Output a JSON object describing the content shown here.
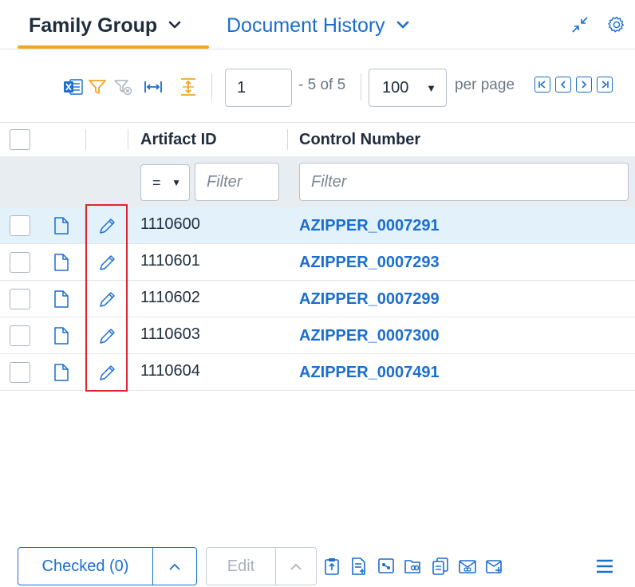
{
  "tabs": [
    {
      "label": "Family Group",
      "chevron": "⌄",
      "active": true
    },
    {
      "label": "Document History",
      "chevron": "⌄",
      "active": false
    }
  ],
  "tab_icons": [
    "collapse-arrows-icon",
    "gear-icon"
  ],
  "toolbar": {
    "page_input_value": "1",
    "page_range": "- 5 of 5",
    "per_page_value": "100",
    "per_page_label": "per page",
    "pager_buttons": [
      "|<",
      "<",
      ">",
      ">|"
    ]
  },
  "grid": {
    "columns": [
      "Artifact ID",
      "Control Number"
    ],
    "filter": {
      "operator": "=",
      "artifact_placeholder": "Filter",
      "control_placeholder": "Filter"
    },
    "rows": [
      {
        "artifact_id": "1110600",
        "control_number": "AZIPPER_0007291",
        "selected": true
      },
      {
        "artifact_id": "1110601",
        "control_number": "AZIPPER_0007293",
        "selected": false
      },
      {
        "artifact_id": "1110602",
        "control_number": "AZIPPER_0007299",
        "selected": false
      },
      {
        "artifact_id": "1110603",
        "control_number": "AZIPPER_0007300",
        "selected": false
      },
      {
        "artifact_id": "1110604",
        "control_number": "AZIPPER_0007491",
        "selected": false
      }
    ]
  },
  "footer": {
    "checked_label": "Checked (0)",
    "edit_label": "Edit"
  },
  "colors": {
    "accent": "#1a6ecf",
    "tab_underline": "#f3a524",
    "filter_icon": "#f3a524",
    "highlight": "#d9262d",
    "selected_row": "#e3f1fb"
  }
}
